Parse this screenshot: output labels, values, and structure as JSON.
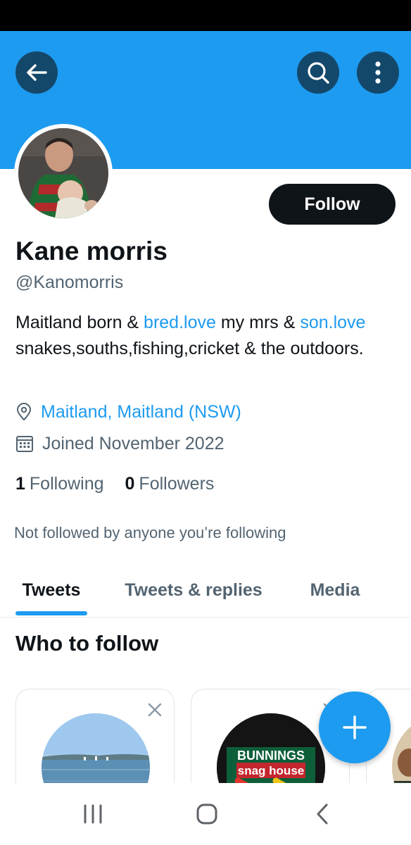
{
  "colors": {
    "banner": "#1d9bf0",
    "accent": "#1d9bf0",
    "header_button_bg": "#14486b",
    "primary_text": "#0f1419",
    "secondary_text": "#536471",
    "follow_button_bg": "#0f1419"
  },
  "header": {
    "back_icon": "arrow-left-icon",
    "search_icon": "search-icon",
    "more_icon": "more-vertical-icon"
  },
  "profile": {
    "follow_label": "Follow",
    "name": "Kane morris",
    "handle": "@Kanomorris",
    "bio": {
      "part1": "Maitland born & ",
      "link1": "bred.love",
      "part2": " my mrs & ",
      "link2": "son.love",
      "part3": " snakes,souths,fishing,cricket & the outdoors."
    },
    "location": "Maitland, Maitland (NSW)",
    "joined": "Joined November 2022",
    "following_count": "1",
    "following_label": "Following",
    "followers_count": "0",
    "followers_label": "Followers",
    "not_followed": "Not followed by anyone you’re following"
  },
  "tabs": [
    {
      "label": "Tweets",
      "active": true
    },
    {
      "label": "Tweets & replies",
      "active": false
    },
    {
      "label": "Media",
      "active": false
    }
  ],
  "who_to_follow": {
    "title": "Who to follow",
    "cards": [
      {
        "image": "lake-photo",
        "close_icon": "close-icon"
      },
      {
        "image": "bunnings-logo",
        "logo_text": "BUNNINGS snag house",
        "close_icon": "close-icon"
      },
      {
        "image": "person-photo"
      }
    ]
  },
  "fab": {
    "icon": "plus-icon"
  },
  "system_nav": {
    "recents_icon": "recents-icon",
    "home_icon": "home-icon",
    "back_icon": "chevron-left-icon"
  }
}
